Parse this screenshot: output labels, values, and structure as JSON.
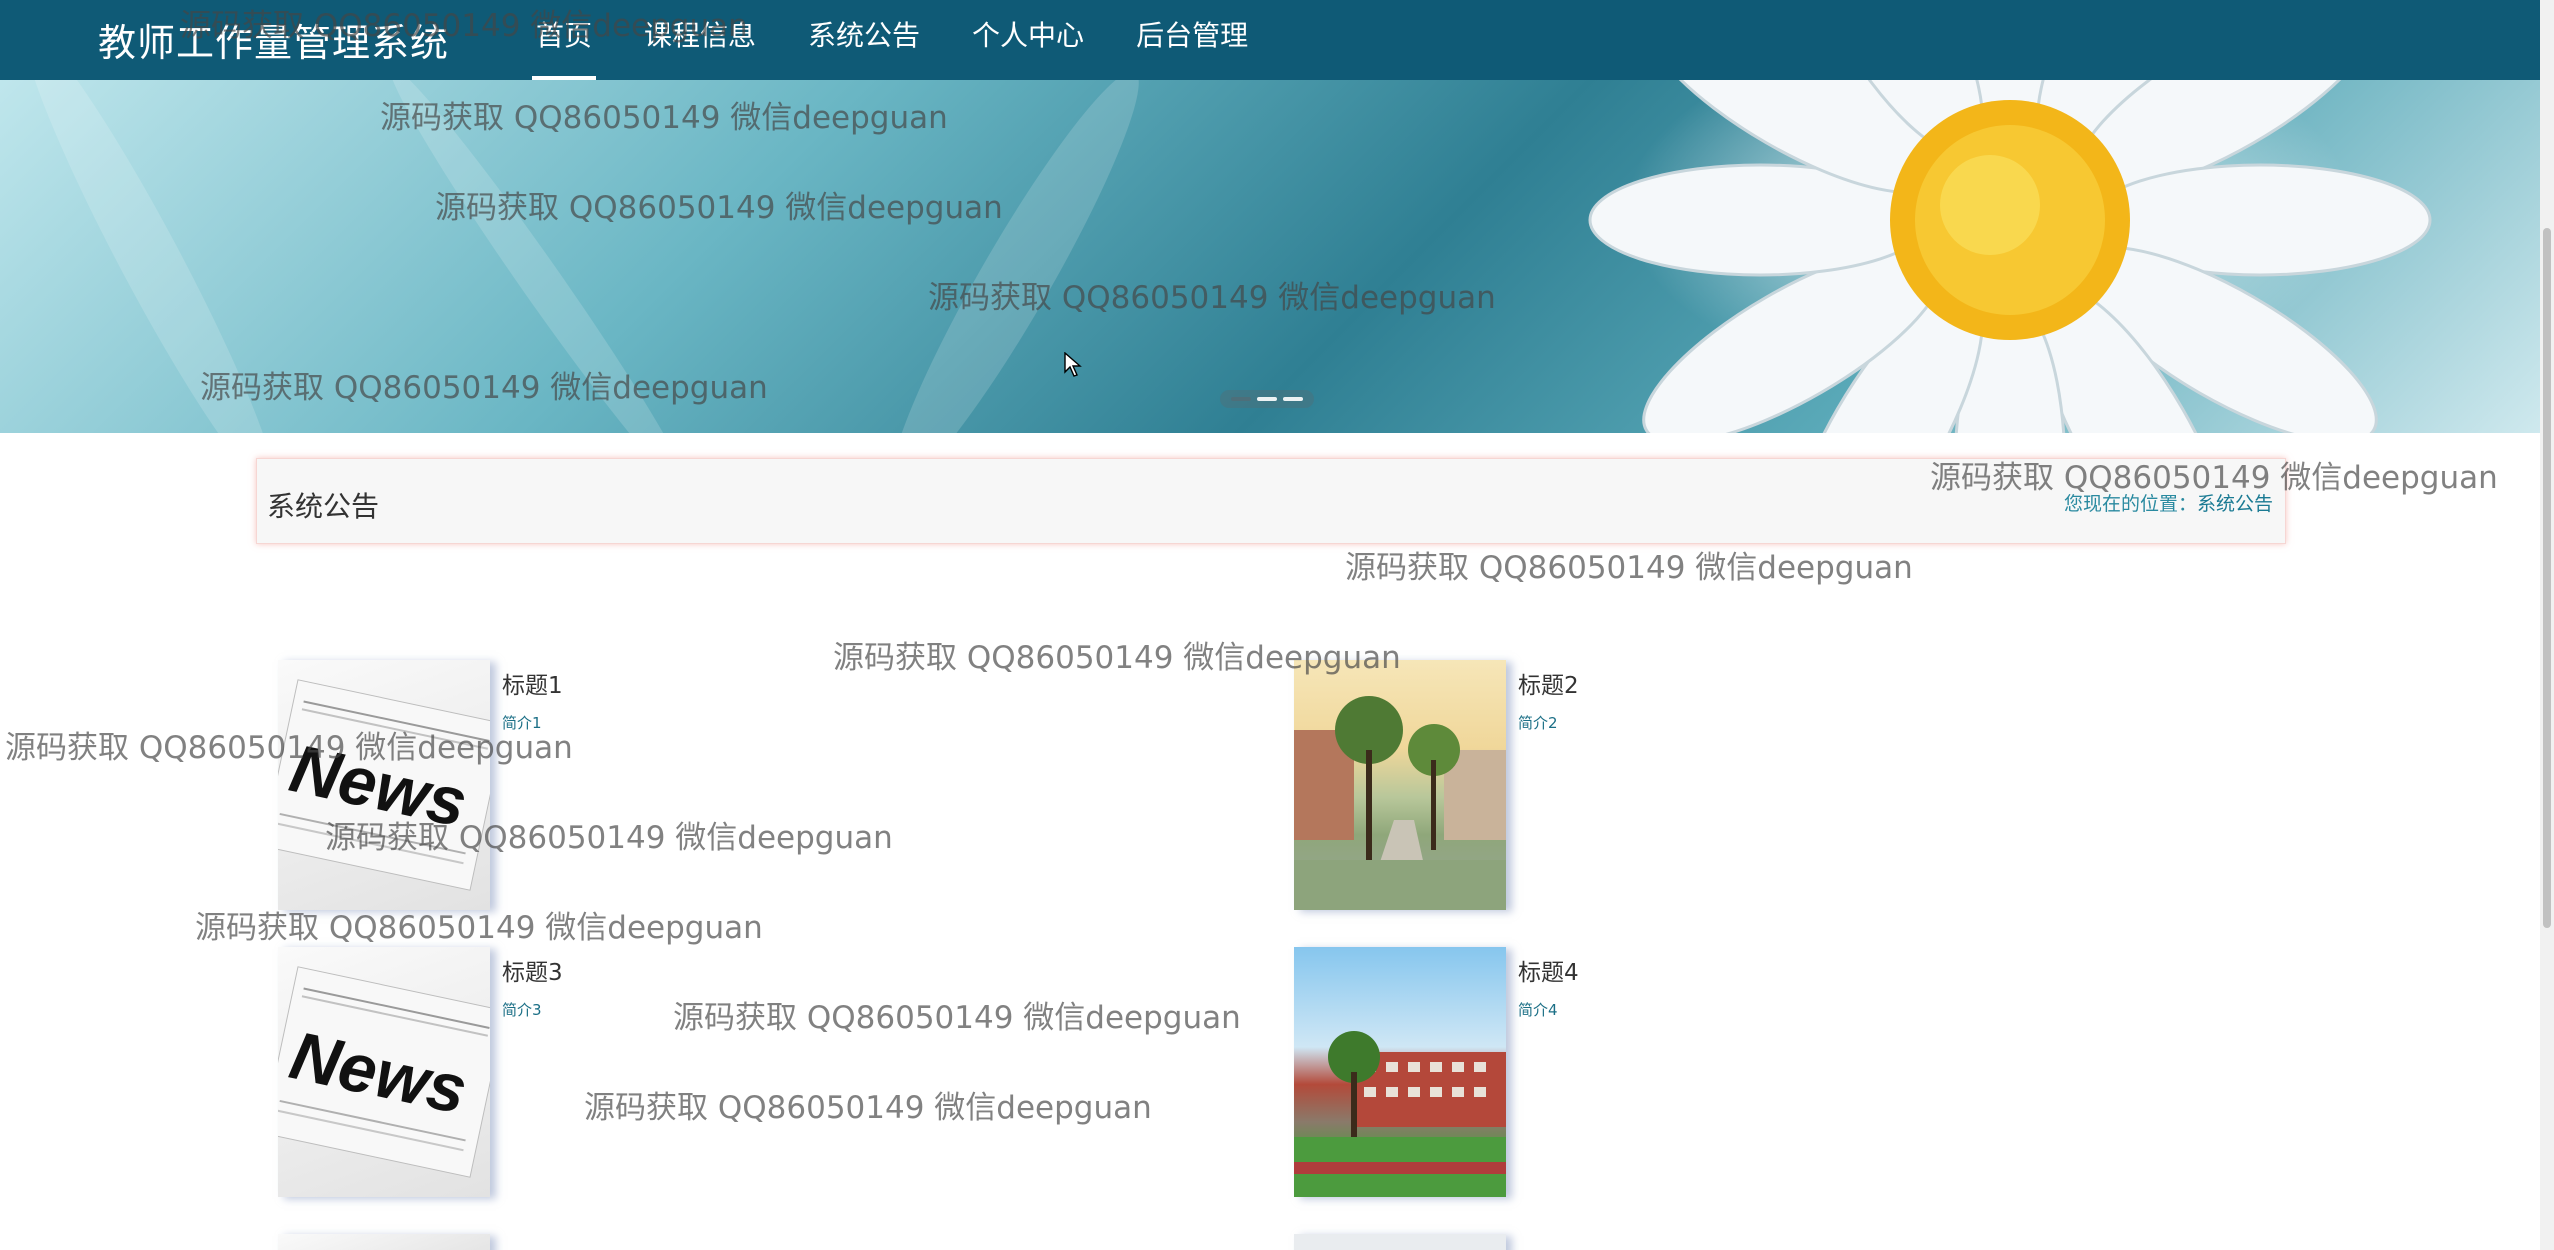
{
  "app": {
    "title": "教师工作量管理系统"
  },
  "nav": [
    {
      "label": "首页",
      "active": true
    },
    {
      "label": "课程信息",
      "active": false
    },
    {
      "label": "系统公告",
      "active": false
    },
    {
      "label": "个人中心",
      "active": false
    },
    {
      "label": "后台管理",
      "active": false
    }
  ],
  "banner": {
    "slide_count": 3,
    "active_slide": 1
  },
  "section": {
    "title": "系统公告",
    "breadcrumb_prefix": "您现在的位置：",
    "breadcrumb_current": "系统公告"
  },
  "news": [
    {
      "title": "标题1",
      "intro": "简介1",
      "image": "news-newspaper"
    },
    {
      "title": "标题2",
      "intro": "简介2",
      "image": "campus-trees"
    },
    {
      "title": "标题3",
      "intro": "简介3",
      "image": "news-newspaper"
    },
    {
      "title": "标题4",
      "intro": "简介4",
      "image": "campus-building"
    }
  ],
  "watermark_text": "源码获取 QQ86050149 微信deepguan",
  "colors": {
    "nav_bg": "#0f5a76",
    "link": "#1b6f86",
    "section_border": "#f6d6d3"
  }
}
